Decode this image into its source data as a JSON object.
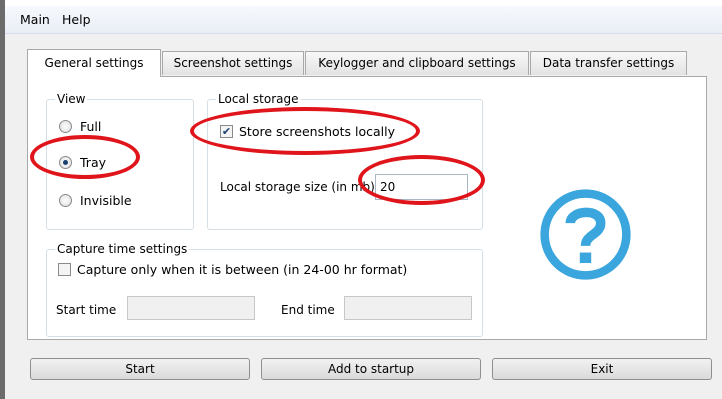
{
  "menu": {
    "main": "Main",
    "help": "Help"
  },
  "tabs": [
    {
      "label": "General settings"
    },
    {
      "label": "Screenshot settings"
    },
    {
      "label": "Keylogger and clipboard settings"
    },
    {
      "label": "Data transfer settings"
    }
  ],
  "view_group": {
    "title": "View",
    "options": [
      "Full",
      "Tray",
      "Invisible"
    ],
    "selected": "Tray"
  },
  "local_storage": {
    "title": "Local storage",
    "store_locally_label": "Store screenshots locally",
    "store_locally_checked": true,
    "size_label": "Local storage size (in mb)",
    "size_value": "20"
  },
  "capture_time": {
    "title": "Capture time settings",
    "only_between_label": "Capture only when it is between (in 24-00 hr format)",
    "only_between_checked": false,
    "start_label": "Start time",
    "start_value": "",
    "end_label": "End time",
    "end_value": ""
  },
  "buttons": {
    "start": "Start",
    "add_to_startup": "Add to startup",
    "exit": "Exit"
  },
  "icons": {
    "help": "question-circle-icon"
  },
  "colors": {
    "help_icon": "#3aa6dd",
    "annotation": "#e0151b"
  }
}
